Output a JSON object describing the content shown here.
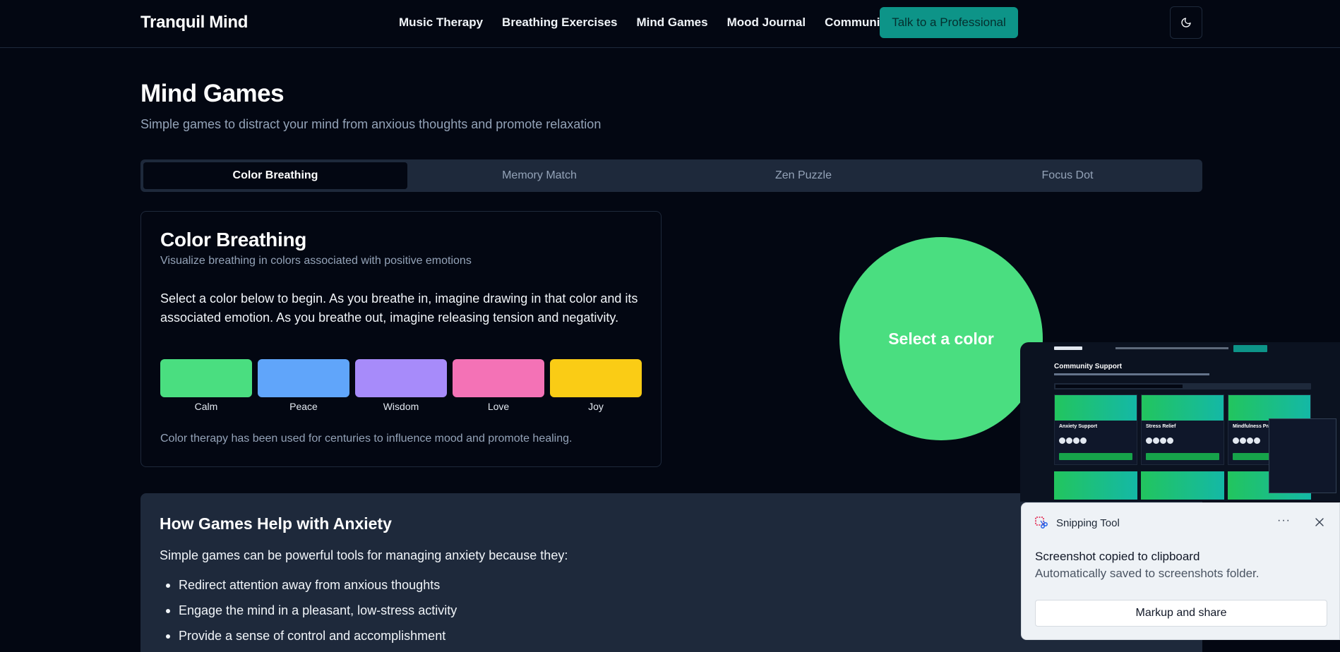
{
  "header": {
    "brand": "Tranquil Mind",
    "nav": [
      "Music Therapy",
      "Breathing Exercises",
      "Mind Games",
      "Mood Journal",
      "Community"
    ],
    "cta_label": "Talk to a Professional",
    "theme_icon": "moon-icon"
  },
  "page": {
    "title": "Mind Games",
    "subtitle": "Simple games to distract your mind from anxious thoughts and promote relaxation"
  },
  "tabs": [
    {
      "label": "Color Breathing",
      "active": true
    },
    {
      "label": "Memory Match",
      "active": false
    },
    {
      "label": "Zen Puzzle",
      "active": false
    },
    {
      "label": "Focus Dot",
      "active": false
    }
  ],
  "game": {
    "title": "Color Breathing",
    "subtitle": "Visualize breathing in colors associated with positive emotions",
    "description": "Select a color below to begin. As you breathe in, imagine drawing in that color and its associated emotion. As you breathe out, imagine releasing tension and negativity.",
    "colors": [
      {
        "label": "Calm",
        "hex": "#4ade80"
      },
      {
        "label": "Peace",
        "hex": "#60a5fa"
      },
      {
        "label": "Wisdom",
        "hex": "#a78bfa"
      },
      {
        "label": "Love",
        "hex": "#f472b6"
      },
      {
        "label": "Joy",
        "hex": "#facc15"
      }
    ],
    "note": "Color therapy has been used for centuries to influence mood and promote healing.",
    "circle_label": "Select a color",
    "circle_color": "#4ade80"
  },
  "info": {
    "title": "How Games Help with Anxiety",
    "lead": "Simple games can be powerful tools for managing anxiety because they:",
    "points": [
      "Redirect attention away from anxious thoughts",
      "Engage the mind in a pleasant, low-stress activity",
      "Provide a sense of control and accomplishment"
    ]
  },
  "preview": {
    "title": "Community Support",
    "cards": [
      "Anxiety Support",
      "Stress Relief",
      "Mindfulness Pra..."
    ]
  },
  "notification": {
    "app": "Snipping Tool",
    "more_label": "···",
    "title": "Screenshot copied to clipboard",
    "body": "Automatically saved to screenshots folder.",
    "button": "Markup and share"
  },
  "colors": {
    "background": "#030712",
    "accent": "#0d9488",
    "panel": "#1e293b"
  }
}
